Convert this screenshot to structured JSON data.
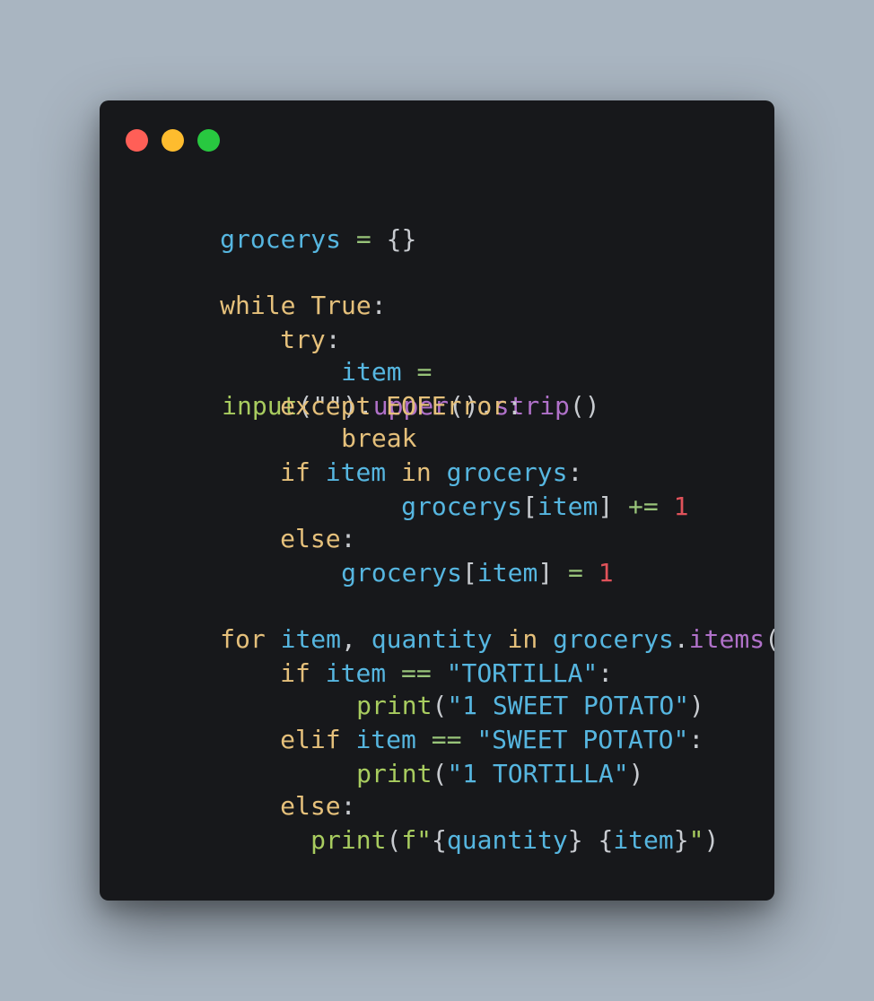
{
  "window": {
    "controls": {
      "close": "close-dot",
      "minimize": "minimize-dot",
      "maximize": "maximize-dot"
    },
    "colors": {
      "background": "#a9b5c1",
      "window": "#17181b",
      "close": "#ff5f57",
      "minimize": "#febc2e",
      "maximize": "#28c840",
      "keyword": "#e5c07b",
      "variable": "#56b6e0",
      "operator": "#98c379",
      "number": "#e0525a",
      "method": "#b071c9",
      "function": "#a8cc5f"
    }
  },
  "code": {
    "l1": {
      "t1": "grocerys",
      "t2": " = ",
      "t3": "{}"
    },
    "l2": {
      "t1": "while",
      "t2": " ",
      "t3": "True",
      "t4": ":"
    },
    "l3": {
      "t1": "try",
      "t2": ":"
    },
    "l4": {
      "t1": "item",
      "t2": " ="
    },
    "l5": {
      "t1": "input",
      "t2": "(\"\")",
      "t3": ".",
      "t4": "upper",
      "t5": "()",
      "t6": ".",
      "t7": "strip",
      "t8": "()"
    },
    "l5b": {
      "t1": "except",
      "t2": " ",
      "t3": "EOFError",
      "t4": ":"
    },
    "l6": {
      "t1": "break"
    },
    "l7": {
      "t1": "if",
      "t2": " ",
      "t3": "item",
      "t4": " ",
      "t5": "in",
      "t6": " ",
      "t7": "grocerys",
      "t8": ":"
    },
    "l8": {
      "t1": "grocerys",
      "t2": "[",
      "t3": "item",
      "t4": "]",
      "t5": " += ",
      "t6": "1"
    },
    "l9": {
      "t1": "else",
      "t2": ":"
    },
    "l10": {
      "t1": "grocerys",
      "t2": "[",
      "t3": "item",
      "t4": "]",
      "t5": " = ",
      "t6": "1"
    },
    "l11": {
      "t1": "for",
      "t2": " ",
      "t3": "item",
      "t4": ", ",
      "t5": "quantity",
      "t6": " ",
      "t7": "in",
      "t8": " ",
      "t9": "grocerys",
      "t10": ".",
      "t11": "items",
      "t12": "():"
    },
    "l12": {
      "t1": "if",
      "t2": " ",
      "t3": "item",
      "t4": " == ",
      "t5": "\"TORTILLA\"",
      "t6": ":"
    },
    "l13": {
      "t1": "print",
      "t2": "(",
      "t3": "\"1 SWEET POTATO\"",
      "t4": ")"
    },
    "l14": {
      "t1": "elif",
      "t2": " ",
      "t3": "item",
      "t4": " == ",
      "t5": "\"SWEET POTATO\"",
      "t6": ":"
    },
    "l15": {
      "t1": "print",
      "t2": "(",
      "t3": "\"1 TORTILLA\"",
      "t4": ")"
    },
    "l16": {
      "t1": "else",
      "t2": ":"
    },
    "l17": {
      "t1": "print",
      "t2": "(",
      "t3": "f\"",
      "t4": "{",
      "t5": "quantity",
      "t6": "}",
      "t7": " ",
      "t8": "{",
      "t9": "item",
      "t10": "}",
      "t11": "\"",
      "t12": ")"
    }
  }
}
